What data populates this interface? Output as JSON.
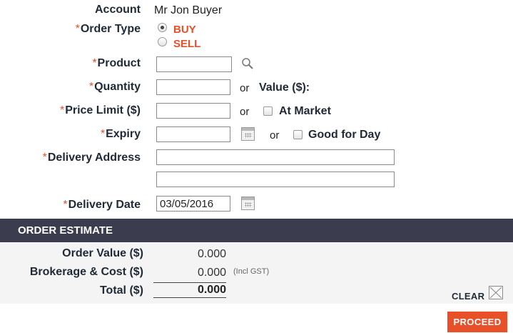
{
  "form": {
    "account_label": "Account",
    "account_value": "Mr Jon Buyer",
    "required_mark": "*",
    "order_type_label": "Order Type",
    "order_type_options": [
      "BUY",
      "SELL"
    ],
    "order_type_selected": "BUY",
    "product_label": "Product",
    "product_value": "",
    "quantity_label": "Quantity",
    "quantity_value": "",
    "or_text": "or",
    "value_label": "Value ($):",
    "price_limit_label": "Price Limit ($)",
    "price_limit_value": "",
    "at_market_label": "At Market",
    "at_market_checked": false,
    "expiry_label": "Expiry",
    "expiry_value": "",
    "good_for_day_label": "Good for Day",
    "good_for_day_checked": false,
    "delivery_address_label": "Delivery Address",
    "delivery_address_line1": "",
    "delivery_address_line2": "",
    "delivery_date_label": "Delivery Date",
    "delivery_date_value": "03/05/2016"
  },
  "estimate": {
    "header": "ORDER ESTIMATE",
    "order_value_label": "Order Value ($)",
    "order_value": "0.000",
    "brokerage_label": "Brokerage & Cost ($)",
    "brokerage_value": "0.000",
    "incl_gst": "(Incl GST)",
    "total_label": "Total ($)",
    "total_value": "0.000"
  },
  "actions": {
    "clear_label": "CLEAR",
    "proceed_label": "PROCEED"
  },
  "colors": {
    "accent": "#e8502a",
    "header_bg": "#3b3c4e",
    "estimate_bg": "#f4f4f4"
  },
  "icons": {
    "product_search": "search-icon",
    "expiry_calendar": "calendar-icon",
    "delivery_calendar": "calendar-icon",
    "clear": "clear-x-icon"
  }
}
